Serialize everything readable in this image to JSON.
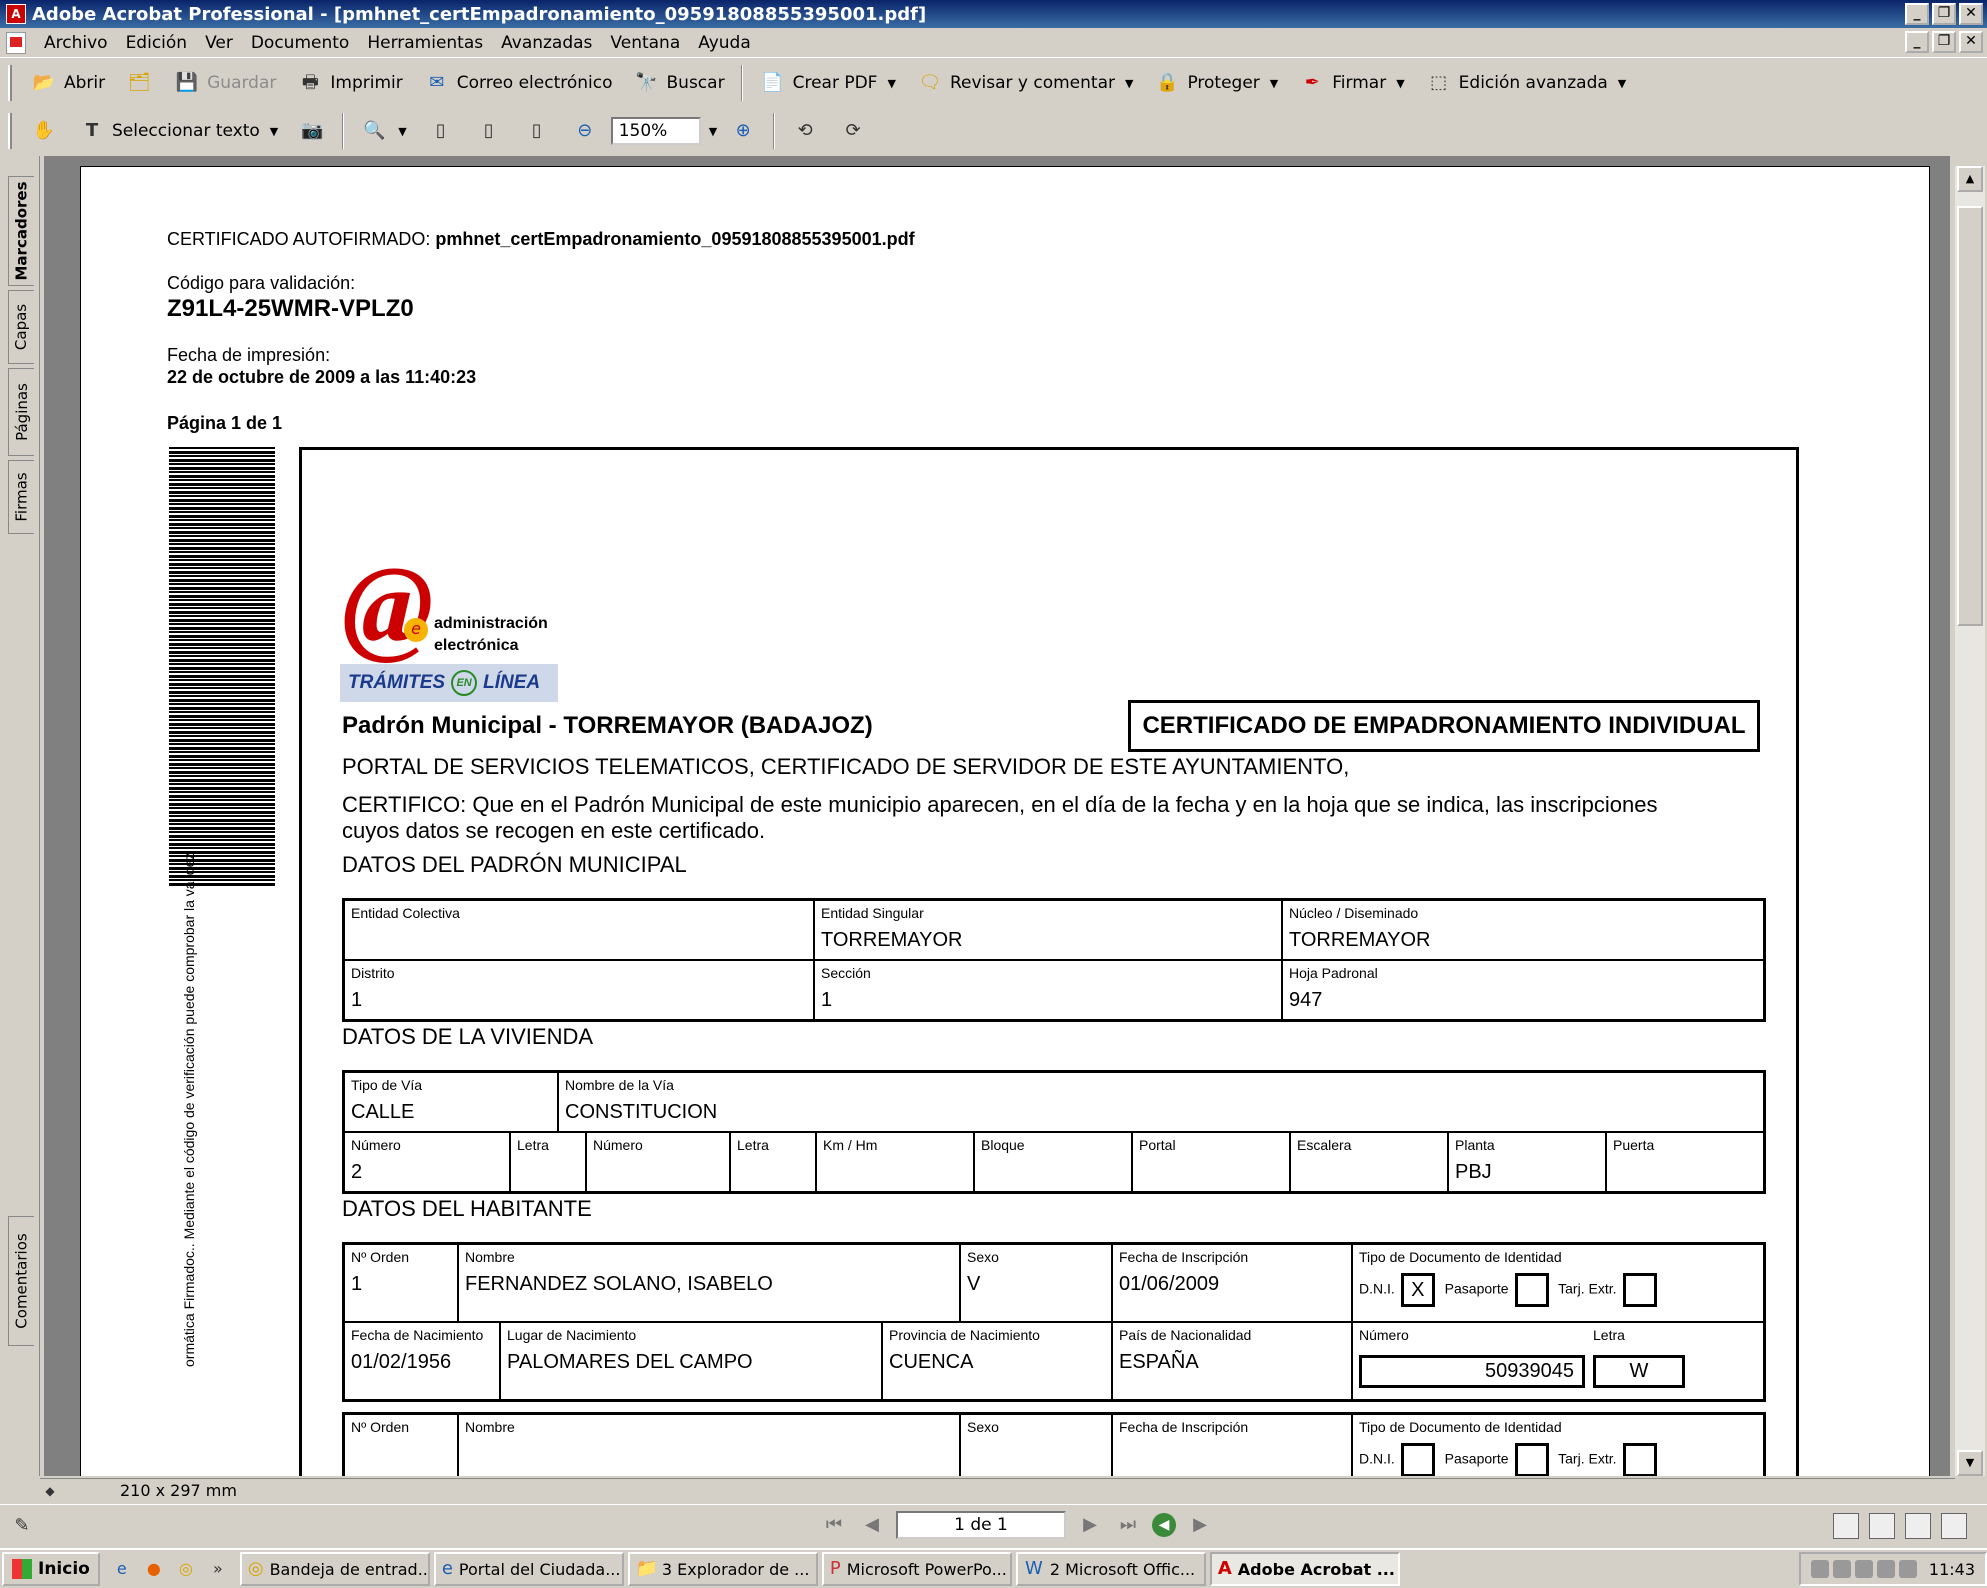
{
  "window": {
    "title": "Adobe Acrobat Professional - [pmhnet_certEmpadronamiento_09591808855395001.pdf]"
  },
  "menu": [
    "Archivo",
    "Edición",
    "Ver",
    "Documento",
    "Herramientas",
    "Avanzadas",
    "Ventana",
    "Ayuda"
  ],
  "toolbar1": {
    "open": "Abrir",
    "save": "Guardar",
    "print": "Imprimir",
    "email": "Correo electrónico",
    "search": "Buscar",
    "create_pdf": "Crear PDF",
    "review": "Revisar y comentar",
    "protect": "Proteger",
    "sign": "Firmar",
    "advanced": "Edición avanzada"
  },
  "toolbar2": {
    "select_text": "Seleccionar texto",
    "zoom": "150%"
  },
  "side_tabs": [
    "Marcadores",
    "Capas",
    "Páginas",
    "Firmas",
    "Comentarios"
  ],
  "page_size": "210 x 297 mm",
  "nav": {
    "page_indicator": "1 de 1"
  },
  "document": {
    "cert_label": "CERTIFICADO AUTOFIRMADO:",
    "cert_file": "pmhnet_certEmpadronamiento_09591808855395001.pdf",
    "validation_label": "Código para validación:",
    "validation_code": "Z91L4-25WMR-VPLZ0",
    "print_date_label": "Fecha de impresión:",
    "print_date": "22 de octubre de 2009 a las 11:40:23",
    "page_of": "Página 1 de 1",
    "vertical_note": "ormática Firmadoc.. Mediante el código de verificación puede comprobar la validez",
    "logo_text_1": "administración",
    "logo_text_2": "electrónica",
    "tramites": "TRÁMITES EN LÍNEA",
    "tramites_word1": "TRÁMITES",
    "tramites_word2": "EN",
    "tramites_word3": "LÍNEA",
    "municipality": "Padrón Municipal - TORREMAYOR (BADAJOZ)",
    "cert_title": "CERTIFICADO DE EMPADRONAMIENTO INDIVIDUAL",
    "portal_line": "PORTAL DE SERVICIOS TELEMATICOS, CERTIFICADO DE SERVIDOR DE ESTE AYUNTAMIENTO,",
    "certifico_1": "CERTIFICO: Que en el Padrón Municipal de este municipio aparecen, en el día de  la fecha y en la hoja que se indica, las inscripciones",
    "certifico_2": "cuyos datos se recogen en este certificado.",
    "section_padron": "DATOS DEL PADRÓN MUNICIPAL",
    "padron": {
      "entidad_colectiva_lbl": "Entidad Colectiva",
      "entidad_colectiva": "",
      "entidad_singular_lbl": "Entidad Singular",
      "entidad_singular": "TORREMAYOR",
      "nucleo_lbl": "Núcleo / Diseminado",
      "nucleo": "TORREMAYOR",
      "distrito_lbl": "Distrito",
      "distrito": "1",
      "seccion_lbl": "Sección",
      "seccion": "1",
      "hoja_lbl": "Hoja Padronal",
      "hoja": "947"
    },
    "section_vivienda": "DATOS DE LA VIVIENDA",
    "vivienda": {
      "tipo_via_lbl": "Tipo de Vía",
      "tipo_via": "CALLE",
      "nombre_via_lbl": "Nombre de la Vía",
      "nombre_via": "CONSTITUCION",
      "numero_lbl": "Número",
      "numero": "2",
      "letra_lbl": "Letra",
      "numero2_lbl": "Número",
      "letra2_lbl": "Letra",
      "km_lbl": "Km / Hm",
      "bloque_lbl": "Bloque",
      "portal_lbl": "Portal",
      "escalera_lbl": "Escalera",
      "planta_lbl": "Planta",
      "planta": "PBJ",
      "puerta_lbl": "Puerta"
    },
    "section_habitante": "DATOS DEL HABITANTE",
    "habitante": {
      "orden_lbl": "Nº Orden",
      "orden": "1",
      "nombre_lbl": "Nombre",
      "nombre": "FERNANDEZ SOLANO, ISABELO",
      "sexo_lbl": "Sexo",
      "sexo": "V",
      "fecha_insc_lbl": "Fecha de Inscripción",
      "fecha_insc": "01/06/2009",
      "tipo_doc_lbl": "Tipo de Documento de Identidad",
      "dni_lbl": "D.N.I.",
      "dni_mark": "X",
      "pasaporte_lbl": "Pasaporte",
      "tarj_lbl": "Tarj. Extr.",
      "fecha_nac_lbl": "Fecha de Nacimiento",
      "fecha_nac": "01/02/1956",
      "lugar_nac_lbl": "Lugar de Nacimiento",
      "lugar_nac": "PALOMARES DEL CAMPO",
      "prov_nac_lbl": "Provincia de Nacimiento",
      "prov_nac": "CUENCA",
      "pais_lbl": "País de Nacionalidad",
      "pais": "ESPAÑA",
      "numero_lbl": "Número",
      "numero": "50939045",
      "letra_lbl": "Letra",
      "letra": "W"
    }
  },
  "taskbar": {
    "start": "Inicio",
    "tasks": [
      "Bandeja de entrad...",
      "Portal del Ciudada...",
      "3 Explorador de ...",
      "Microsoft PowerPo...",
      "2 Microsoft Offic...",
      "Adobe Acrobat ..."
    ],
    "clock": "11:43"
  }
}
